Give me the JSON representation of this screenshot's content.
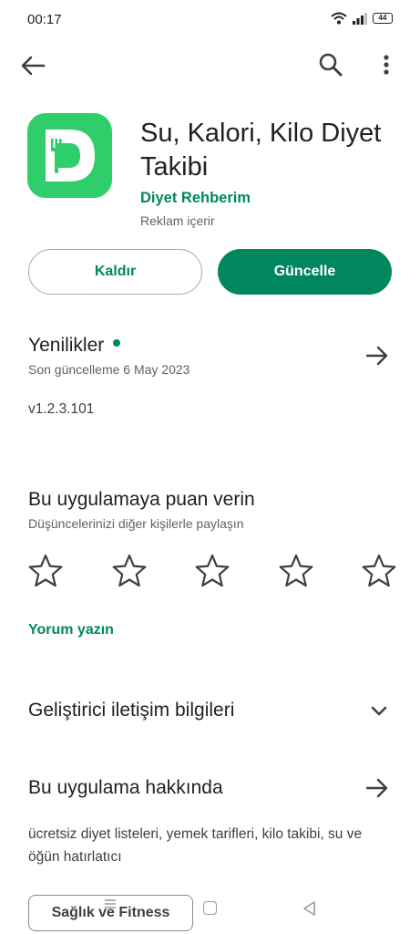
{
  "status_bar": {
    "time": "00:17",
    "battery": "44",
    "icons": [
      "wifi-icon",
      "signal-icon",
      "battery-icon"
    ]
  },
  "top_bar": {
    "icons": [
      "back-arrow-icon",
      "search-icon",
      "more-vert-icon"
    ]
  },
  "app": {
    "title": "Su, Kalori, Kilo Diyet Takibi",
    "developer": "Diyet Rehberim",
    "ads_note": "Reklam içerir",
    "icon_color": "#2fce6a"
  },
  "actions": {
    "uninstall_label": "Kaldır",
    "update_label": "Güncelle",
    "accent_color": "#01875f"
  },
  "whats_new": {
    "title": "Yenilikler",
    "last_updated": "Son güncelleme 6 May 2023",
    "version": "v1.2.3.101"
  },
  "rate": {
    "title": "Bu uygulamaya puan verin",
    "subtitle": "Düşüncelerinizi diğer kişilerle paylaşın",
    "star_count": 5,
    "write_review": "Yorum yazın"
  },
  "developer_contact": {
    "title": "Geliştirici iletişim bilgileri"
  },
  "about": {
    "title": "Bu uygulama hakkında",
    "description": "ücretsiz diyet listeleri, yemek tarifleri, kilo takibi, su ve öğün hatırlatıcı"
  },
  "category_chip": {
    "label": "Sağlık ve Fitness"
  },
  "nav_bar": {
    "icons": [
      "menu-icon",
      "home-icon",
      "back-triangle-icon"
    ]
  }
}
